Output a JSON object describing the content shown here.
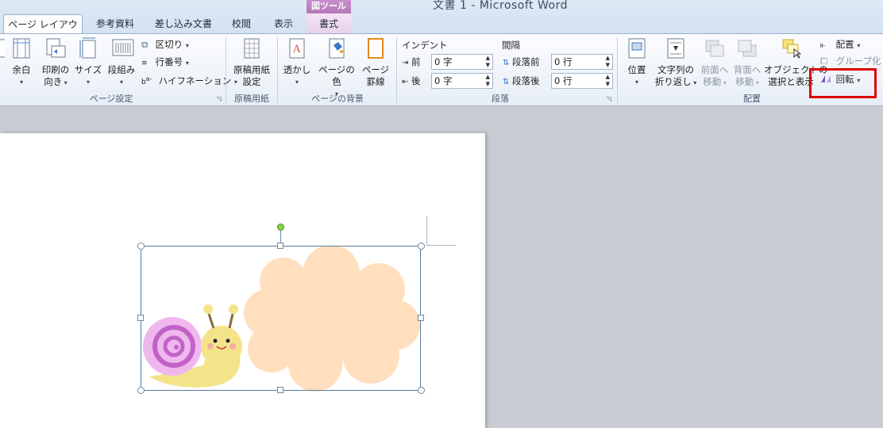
{
  "window": {
    "title": "文書 1 - Microsoft Word"
  },
  "context_tab_group": {
    "label": "図ツール",
    "color": "#b577b9"
  },
  "tabs": [
    {
      "label": "ページ レイアウト",
      "active": true
    },
    {
      "label": "参考資料"
    },
    {
      "label": "差し込み文書"
    },
    {
      "label": "校閲"
    },
    {
      "label": "表示"
    },
    {
      "label": "書式"
    }
  ],
  "page_setup": {
    "margin_label": "余白",
    "orientation_line1": "印刷の",
    "orientation_line2": "向き",
    "size_label": "サイズ",
    "columns_label": "段組み",
    "breaks_label": "区切り",
    "line_numbers_label": "行番号",
    "hyphenation_label": "ハイフネーション",
    "group_label": "ページ設定"
  },
  "manuscript": {
    "btn_line1": "原稿用紙",
    "btn_line2": "設定",
    "group_label": "原稿用紙"
  },
  "page_background": {
    "watermark_label": "透かし",
    "page_color_label": "ページの色",
    "borders_line1": "ページ",
    "borders_line2": "罫線",
    "group_label": "ページの背景"
  },
  "paragraph": {
    "indent_header": "インデント",
    "spacing_header": "間隔",
    "indent_before_label": "前",
    "indent_before_value": "0 字",
    "indent_after_label": "後",
    "indent_after_value": "0 字",
    "spacing_before_label": "段落前",
    "spacing_before_value": "0 行",
    "spacing_after_label": "段落後",
    "spacing_after_value": "0 行",
    "group_label": "段落"
  },
  "arrange": {
    "position_label": "位置",
    "wrap_line1": "文字列の",
    "wrap_line2": "折り返し",
    "forward_line1": "前面へ",
    "forward_line2": "移動",
    "backward_line1": "背面へ",
    "backward_line2": "移動",
    "selection_line1": "オブジェクトの",
    "selection_line2": "選択と表示",
    "align_label": "配置",
    "group_btn_label": "グループ化",
    "rotate_label": "回転",
    "group_label": "配置"
  },
  "colors": {
    "highlight": "#dd0000",
    "speech_bubble": "#ffdfbe",
    "snail_body": "#f3e48a",
    "snail_shell": "#f0b7ef",
    "snail_spiral": "#c163c6"
  },
  "icons": {
    "rotate": "rotate-icon",
    "rotation_handle": "rotation-handle-icon"
  }
}
